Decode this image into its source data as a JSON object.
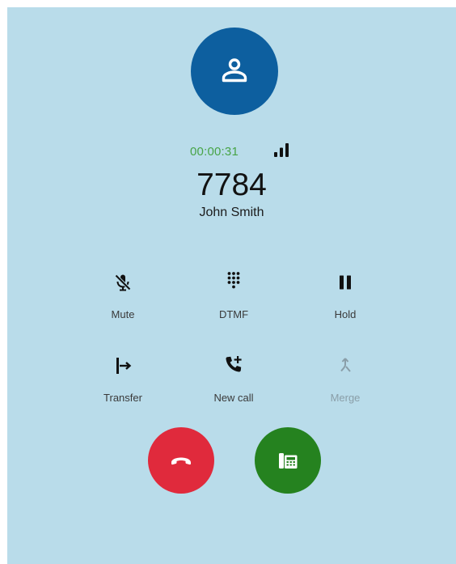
{
  "call": {
    "timer": "00:00:31",
    "number": "7784",
    "name": "John Smith"
  },
  "actions": {
    "mute": "Mute",
    "dtmf": "DTMF",
    "hold": "Hold",
    "transfer": "Transfer",
    "new_call": "New call",
    "merge": "Merge"
  },
  "icons": {
    "avatar": "person-icon",
    "signal": "signal-strength-icon",
    "mute": "mic-off-icon",
    "dtmf": "dialpad-icon",
    "hold": "pause-icon",
    "transfer": "transfer-icon",
    "new_call": "add-call-icon",
    "merge": "merge-icon",
    "hangup": "hang-up-icon",
    "answer": "desk-phone-icon"
  },
  "colors": {
    "background": "#b9dcea",
    "avatar": "#0d5f9f",
    "timer": "#48a447",
    "hangup": "#e02a3c",
    "answer": "#25821f",
    "merge_disabled": "#8a9ea8"
  }
}
